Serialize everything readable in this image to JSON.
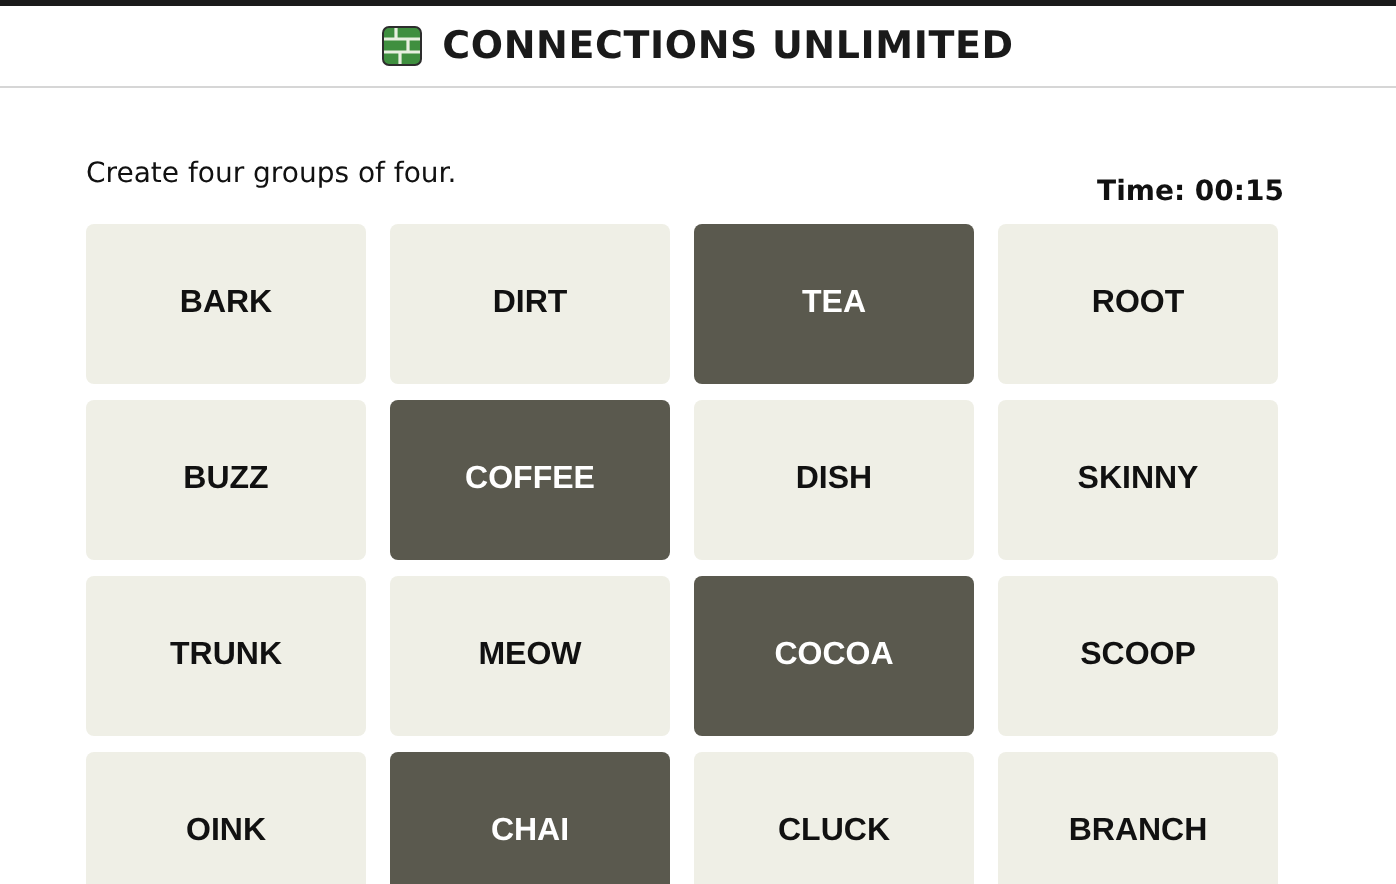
{
  "header": {
    "title": "CONNECTIONS UNLIMITED"
  },
  "instruction": "Create four groups of four.",
  "timer": "Time: 00:15",
  "tiles": [
    {
      "label": "BARK",
      "selected": false
    },
    {
      "label": "DIRT",
      "selected": false
    },
    {
      "label": "TEA",
      "selected": true
    },
    {
      "label": "ROOT",
      "selected": false
    },
    {
      "label": "BUZZ",
      "selected": false
    },
    {
      "label": "COFFEE",
      "selected": true
    },
    {
      "label": "DISH",
      "selected": false
    },
    {
      "label": "SKINNY",
      "selected": false
    },
    {
      "label": "TRUNK",
      "selected": false
    },
    {
      "label": "MEOW",
      "selected": false
    },
    {
      "label": "COCOA",
      "selected": true
    },
    {
      "label": "SCOOP",
      "selected": false
    },
    {
      "label": "OINK",
      "selected": false
    },
    {
      "label": "CHAI",
      "selected": true
    },
    {
      "label": "CLUCK",
      "selected": false
    },
    {
      "label": "BRANCH",
      "selected": false
    }
  ]
}
